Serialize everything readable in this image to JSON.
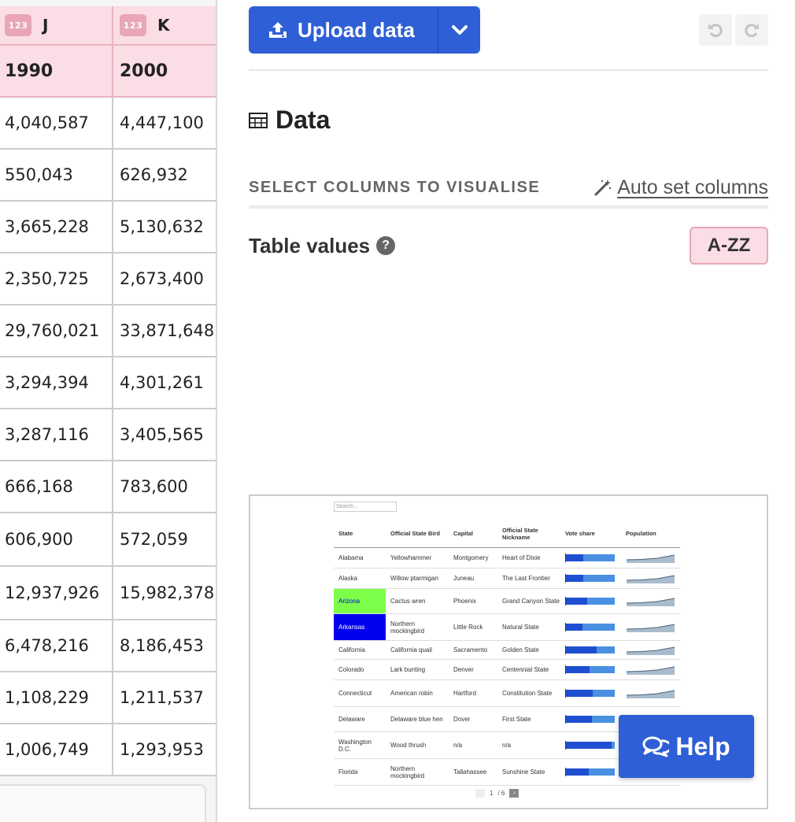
{
  "sheet": {
    "columns": [
      {
        "letter": "J",
        "type_badge": "123",
        "name": "1990"
      },
      {
        "letter": "K",
        "type_badge": "123",
        "name": "2000"
      }
    ],
    "rows": [
      [
        "4,040,587",
        "4,447,100"
      ],
      [
        "550,043",
        "626,932"
      ],
      [
        "3,665,228",
        "5,130,632"
      ],
      [
        "2,350,725",
        "2,673,400"
      ],
      [
        "29,760,021",
        "33,871,648"
      ],
      [
        "3,294,394",
        "4,301,261"
      ],
      [
        "3,287,116",
        "3,405,565"
      ],
      [
        "666,168",
        "783,600"
      ],
      [
        "606,900",
        "572,059"
      ],
      [
        "12,937,926",
        "15,982,378"
      ],
      [
        "6,478,216",
        "8,186,453"
      ],
      [
        "1,108,229",
        "1,211,537"
      ],
      [
        "1,006,749",
        "1,293,953"
      ]
    ]
  },
  "toolbar": {
    "upload_label": "Upload data",
    "upload_icon": "upload-icon",
    "dropdown_icon": "chevron-down-icon",
    "undo_icon": "undo-icon",
    "redo_icon": "redo-icon"
  },
  "data_section": {
    "title": "Data",
    "title_icon": "table-icon",
    "select_label": "SELECT COLUMNS TO VISUALISE",
    "auto_set_label": "Auto set columns",
    "auto_set_icon": "magic-wand-icon",
    "table_values_label": "Table values",
    "table_values_help": "?",
    "table_values_range": "A-ZZ"
  },
  "preview": {
    "search_placeholder": "Search...",
    "headers": [
      "State",
      "Official State Bird",
      "Capital",
      "Official State Nickname",
      "Vote share",
      "Population"
    ],
    "rows": [
      {
        "state": "Alabama",
        "bird": "Yellowhammer",
        "capital": "Montgomery",
        "nickname": "Heart of Dixie",
        "vote_share": 0.37,
        "highlight": ""
      },
      {
        "state": "Alaska",
        "bird": "Willow ptarmigan",
        "capital": "Juneau",
        "nickname": "The Last Frontier",
        "vote_share": 0.37,
        "highlight": ""
      },
      {
        "state": "Arizona",
        "bird": "Cactus wren",
        "capital": "Phoenix",
        "nickname": "Grand Canyon State",
        "vote_share": 0.45,
        "highlight": "#7dff4a"
      },
      {
        "state": "Arkansas",
        "bird": "Northern mockingbird",
        "capital": "Little Rock",
        "nickname": "Natural State",
        "vote_share": 0.35,
        "highlight": "#0000ee"
      },
      {
        "state": "California",
        "bird": "California quail",
        "capital": "Sacramento",
        "nickname": "Golden State",
        "vote_share": 0.63,
        "highlight": ""
      },
      {
        "state": "Colorado",
        "bird": "Lark bunting",
        "capital": "Denver",
        "nickname": "Centennial State",
        "vote_share": 0.49,
        "highlight": ""
      },
      {
        "state": "Connecticut",
        "bird": "American robin",
        "capital": "Hartford",
        "nickname": "Constitution State",
        "vote_share": 0.56,
        "highlight": ""
      },
      {
        "state": "Delaware",
        "bird": "Delaware blue hen",
        "capital": "Dover",
        "nickname": "First State",
        "vote_share": 0.54,
        "highlight": ""
      },
      {
        "state": "Washington D.C.",
        "bird": "Wood thrush",
        "capital": "n/a",
        "nickname": "n/a",
        "vote_share": 0.94,
        "highlight": ""
      },
      {
        "state": "Florida",
        "bird": "Northern mockingbird",
        "capital": "Tallahassee",
        "nickname": "Sunshine State",
        "vote_share": 0.48,
        "highlight": ""
      }
    ],
    "pager": {
      "page": "1",
      "total": "/ 6"
    }
  },
  "help": {
    "label": "Help",
    "icon": "chat-bubbles-icon"
  },
  "colors": {
    "brand_blue": "#2e5fd6",
    "header_pink": "#fbdde5",
    "badge_pink": "#e8a6b8"
  }
}
